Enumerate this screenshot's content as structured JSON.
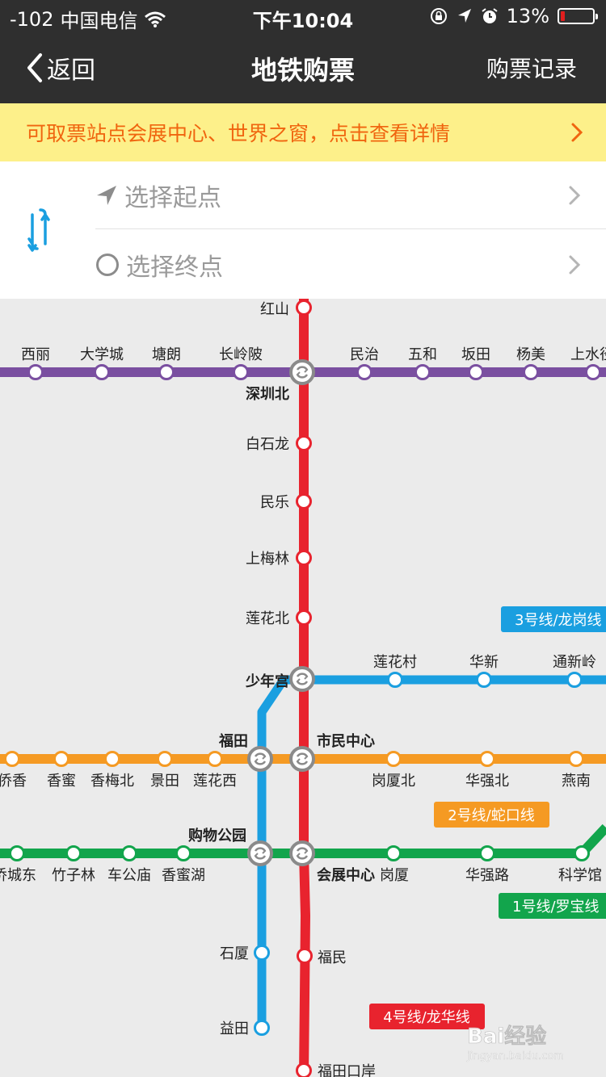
{
  "status_bar": {
    "signal": "-102",
    "carrier": "中国电信",
    "time": "下午10:04",
    "battery": "13%",
    "battery_level": 0.13
  },
  "nav": {
    "back_label": "返回",
    "title": "地铁购票",
    "right_label": "购票记录"
  },
  "notice": {
    "text": "可取票站点会展中心、世界之窗，点击查看详情"
  },
  "route": {
    "start_placeholder": "选择起点",
    "end_placeholder": "选择终点"
  },
  "colors": {
    "line4_red": "#e8232e",
    "line5_purple": "#7a4fa0",
    "line3_blue": "#1a9fe0",
    "line2_orange": "#f59a23",
    "line1_green": "#12a54c",
    "notice_text": "#f0650f",
    "notice_bg": "#fdf08a"
  },
  "map": {
    "line_labels": {
      "line3": "3号线/龙岗线",
      "line2": "2号线/蛇口线",
      "line1": "1号线/罗宝线",
      "line4": "4号线/龙华线"
    },
    "stations": {
      "hongshan": "红山",
      "xili": "西丽",
      "daxuecheng": "大学城",
      "tanglang": "塘朗",
      "changlingpi": "长岭陂",
      "shenzhenbei": "深圳北",
      "minzhi": "民治",
      "wuhe": "五和",
      "bantian": "坂田",
      "yangmei": "杨美",
      "shangshuijing": "上水径",
      "baishilong": "白石龙",
      "minle": "民乐",
      "shangmeilin": "上梅林",
      "lianhuabei": "莲花北",
      "shaoniangong": "少年宫",
      "lianhuacun": "莲花村",
      "huaxin": "华新",
      "tongxinling": "通新岭",
      "futian": "福田",
      "shiminzhongxin": "市民中心",
      "qiaoxiang": "侨香",
      "xiangmi": "香蜜",
      "xiangmeibei": "香梅北",
      "jingtian": "景田",
      "lianhuaxi": "莲花西",
      "gangxiabei": "岗厦北",
      "huaqiangbei": "华强北",
      "yannan": "燕南",
      "gouwugongyuan": "购物公园",
      "qiaochengdong": "侨城东",
      "zhuzilin": "竹子林",
      "chegongmiao": "车公庙",
      "xiangmihu": "香蜜湖",
      "huizhanzhongxin": "会展中心",
      "gangxia": "岗厦",
      "huaqianglu": "华强路",
      "kexueguan": "科学馆",
      "shixia": "石厦",
      "yitian": "益田",
      "fumin": "福民",
      "futiankouan": "福田口岸"
    }
  },
  "watermark": {
    "brand": "Bai经验",
    "url": "jingyan.baidu.com"
  }
}
